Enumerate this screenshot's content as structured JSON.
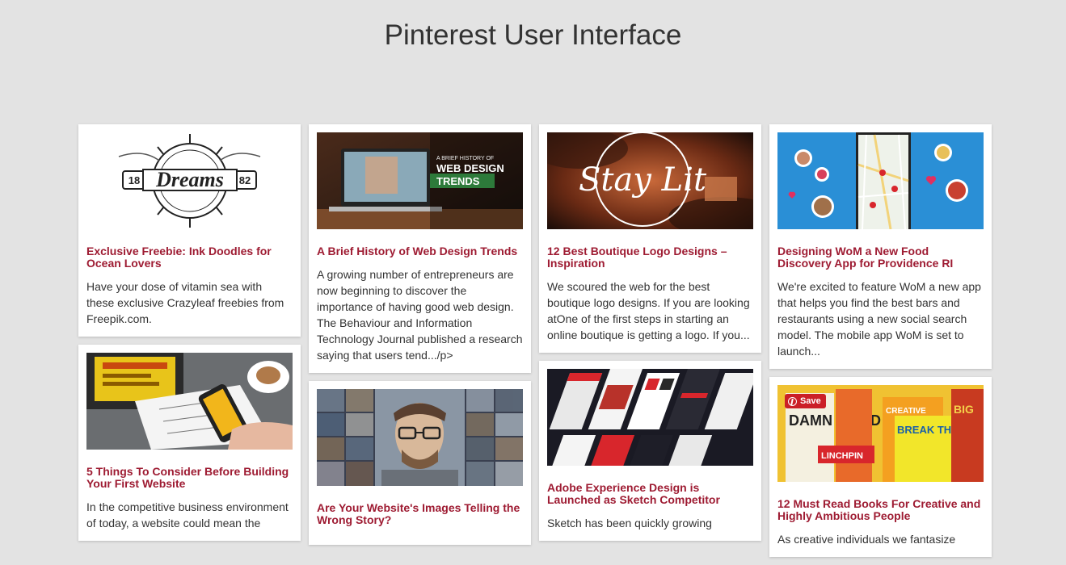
{
  "page": {
    "title": "Pinterest User Interface"
  },
  "save_label": "Save",
  "columns": [
    [
      {
        "title": "Exclusive Freebie: Ink Doodles for Ocean Lovers",
        "text": "Have your dose of vitamin sea with these exclusive Crazyleaf freebies from Freepik.com.",
        "image": {
          "name": "dreams-logo-image",
          "caption": "Dreams",
          "left": "18",
          "right": "82"
        }
      },
      {
        "title": "5 Things To Consider Before Building Your First Website",
        "text": "In the competitive business environment of today, a website could mean the",
        "image": {
          "name": "desk-wireframe-image"
        }
      }
    ],
    [
      {
        "title": "A Brief History of Web Design Trends",
        "text": "A growing number of entrepreneurs are now beginning to discover the importance of having good web design. The Behaviour and Information Technology Journal published a research saying that users tend.../p>",
        "image": {
          "name": "web-design-trends-image",
          "kicker": "A BRIEF HISTORY OF",
          "line1": "WEB DESIGN",
          "line2": "TRENDS"
        }
      },
      {
        "title": "Are Your Website's Images Telling the Wrong Story?",
        "text": "",
        "image": {
          "name": "photo-collage-image"
        }
      }
    ],
    [
      {
        "title": "12 Best Boutique Logo Designs – Inspiration",
        "text": "We scoured the web for the best boutique logo designs. If you are looking atOne of the first steps in starting an online boutique is getting a logo. If you...",
        "image": {
          "name": "stay-lit-image",
          "script": "Stay Lit"
        }
      },
      {
        "title": "Adobe Experience Design is Launched as Sketch Competitor",
        "text": "Sketch has been quickly growing",
        "image": {
          "name": "app-screens-image"
        }
      }
    ],
    [
      {
        "title": "Designing WoM a New Food Discovery App for Providence RI",
        "text": "We're excited to feature WoM a new app that helps you find the best bars and restaurants using a new social search model. The mobile app WoM is set to launch...",
        "image": {
          "name": "food-map-app-image"
        }
      },
      {
        "title": "12 Must Read Books For Creative and Highly Ambitious People",
        "text": "As creative individuals we fantasize",
        "image": {
          "name": "books-image",
          "b1": "DAMN GOOD ADVICE",
          "b2": "LINCHPIN",
          "b3": "BREAK THROUGH",
          "b4": "CREATIVE",
          "b5": "BIG"
        }
      }
    ]
  ],
  "colors": {
    "background": "#e3e3e3",
    "title_link": "#9e1b32",
    "save": "#cb1f27"
  }
}
